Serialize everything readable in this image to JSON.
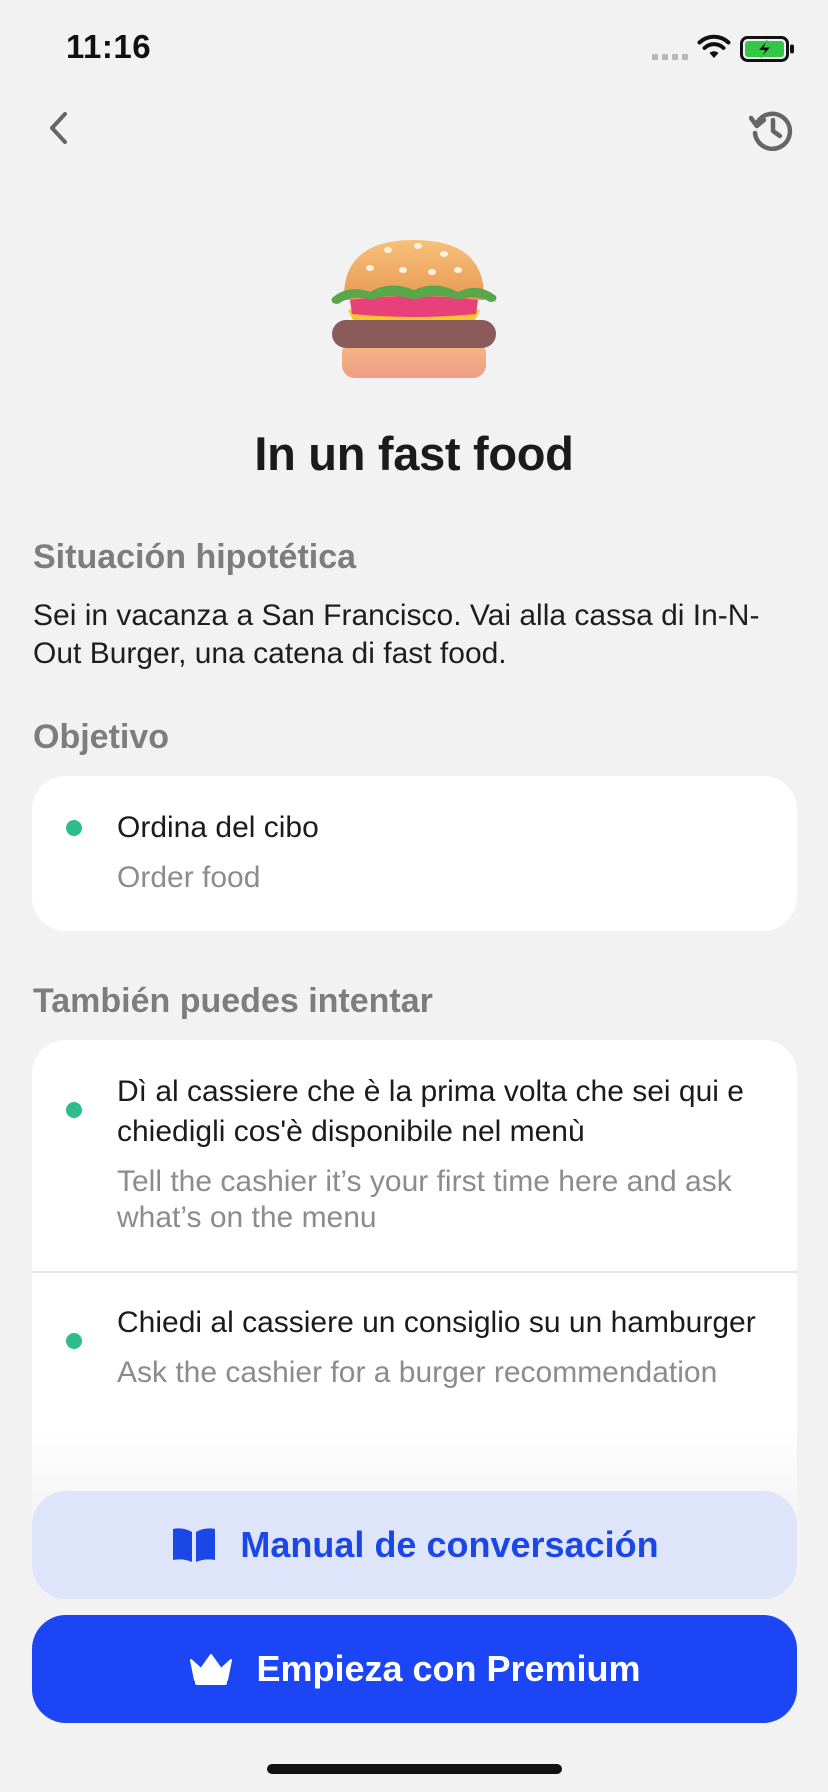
{
  "status_bar": {
    "time": "11:16"
  },
  "nav": {
    "back_icon": "chevron-left-icon",
    "history_icon": "history-icon"
  },
  "hero": {
    "icon": "hamburger-emoji",
    "title": "In un fast food"
  },
  "scenario": {
    "heading": "Situación hipotética",
    "text": "Sei in vacanza a San Francisco. Vai alla cassa di In-N-Out Burger, una catena di fast food."
  },
  "goal": {
    "heading": "Objetivo",
    "items": [
      {
        "text": "Ordina del cibo",
        "translation": "Order food"
      }
    ]
  },
  "also_try": {
    "heading": "También puedes intentar",
    "items": [
      {
        "text": "Dì al cassiere che è la prima volta che sei qui e chiedigli cos'è disponibile nel menù",
        "translation": "Tell the cashier it’s your first time here and ask what’s on the menu"
      },
      {
        "text": "Chiedi al cassiere un consiglio su un hamburger",
        "translation": "Ask the cashier for a burger recommendation"
      }
    ]
  },
  "buttons": {
    "manual_label": "Manual de conversación",
    "manual_icon": "book-icon",
    "premium_label": "Empieza con Premium",
    "premium_icon": "crown-icon"
  },
  "colors": {
    "background": "#f2f2f2",
    "accent": "#1b45f5",
    "accent_light": "#dee4fa",
    "dot_green": "#2ebd8a",
    "battery_green": "#33c748"
  }
}
